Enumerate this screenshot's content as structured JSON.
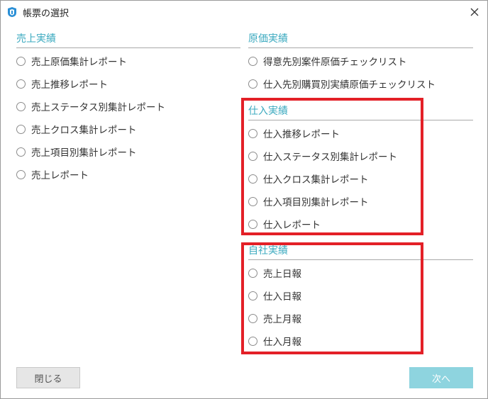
{
  "window": {
    "title": "帳票の選択"
  },
  "sections": {
    "sales": {
      "header": "売上実績",
      "items": [
        "売上原価集計レポート",
        "売上推移レポート",
        "売上ステータス別集計レポート",
        "売上クロス集計レポート",
        "売上項目別集計レポート",
        "売上レポート"
      ]
    },
    "cost": {
      "header": "原価実績",
      "items": [
        "得意先別案件原価チェックリスト",
        "仕入先別購買別実績原価チェックリスト"
      ]
    },
    "purchase": {
      "header": "仕入実績",
      "items": [
        "仕入推移レポート",
        "仕入ステータス別集計レポート",
        "仕入クロス集計レポート",
        "仕入項目別集計レポート",
        "仕入レポート"
      ]
    },
    "company": {
      "header": "自社実績",
      "items": [
        "売上日報",
        "仕入日報",
        "売上月報",
        "仕入月報"
      ]
    }
  },
  "buttons": {
    "close": "閉じる",
    "next": "次へ"
  },
  "colors": {
    "accent": "#3aa9bf",
    "highlight": "#e32027",
    "next_button": "#8ed4df"
  }
}
